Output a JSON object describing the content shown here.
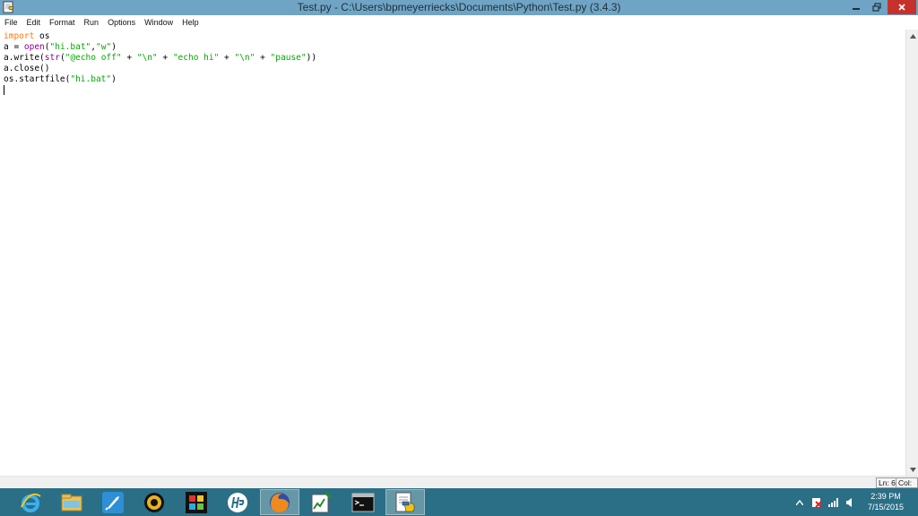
{
  "window": {
    "title": "Test.py - C:\\Users\\bpmeyerriecks\\Documents\\Python\\Test.py (3.4.3)",
    "app_icon": "python-idle-icon",
    "controls": [
      "minimize-icon",
      "maximize-icon",
      "close-icon"
    ]
  },
  "menu": [
    "File",
    "Edit",
    "Format",
    "Run",
    "Options",
    "Window",
    "Help"
  ],
  "editor": {
    "lines": [
      [
        {
          "t": "import",
          "c": "kw"
        },
        {
          "t": " os",
          "c": ""
        }
      ],
      [
        {
          "t": "a = ",
          "c": ""
        },
        {
          "t": "open",
          "c": "bi"
        },
        {
          "t": "(",
          "c": ""
        },
        {
          "t": "\"hi.bat\"",
          "c": "st"
        },
        {
          "t": ",",
          "c": ""
        },
        {
          "t": "\"w\"",
          "c": "st"
        },
        {
          "t": ")",
          "c": ""
        }
      ],
      [
        {
          "t": "a.write(",
          "c": ""
        },
        {
          "t": "str",
          "c": "bi"
        },
        {
          "t": "(",
          "c": ""
        },
        {
          "t": "\"@echo off\"",
          "c": "st"
        },
        {
          "t": " + ",
          "c": ""
        },
        {
          "t": "\"\\n\"",
          "c": "st"
        },
        {
          "t": " + ",
          "c": ""
        },
        {
          "t": "\"echo hi\"",
          "c": "st"
        },
        {
          "t": " + ",
          "c": ""
        },
        {
          "t": "\"\\n\"",
          "c": "st"
        },
        {
          "t": " + ",
          "c": ""
        },
        {
          "t": "\"pause\"",
          "c": "st"
        },
        {
          "t": "))",
          "c": ""
        }
      ],
      [
        {
          "t": "a.close()",
          "c": ""
        }
      ],
      [
        {
          "t": "os.startfile(",
          "c": ""
        },
        {
          "t": "\"hi.bat\"",
          "c": "st"
        },
        {
          "t": ")",
          "c": ""
        }
      ],
      []
    ],
    "colors": {
      "keyword": "#ff7700",
      "builtin": "#900090",
      "string": "#00aa00"
    }
  },
  "status": {
    "line": "Ln: 6",
    "col": "Col: 0"
  },
  "taskbar": {
    "apps": [
      {
        "name": "internet-explorer-icon",
        "active": false
      },
      {
        "name": "file-explorer-icon",
        "active": false
      },
      {
        "name": "rocket-app-icon",
        "active": false
      },
      {
        "name": "media-player-icon",
        "active": false
      },
      {
        "name": "photo-app-icon",
        "active": false
      },
      {
        "name": "hp-icon",
        "active": false
      },
      {
        "name": "firefox-icon",
        "active": true
      },
      {
        "name": "chart-app-icon",
        "active": false
      },
      {
        "name": "command-prompt-icon",
        "active": false
      },
      {
        "name": "python-idle-icon",
        "active": true
      }
    ],
    "tray_icons": [
      "show-hidden-icons-chevron-icon",
      "action-center-icon",
      "network-signal-icon",
      "volume-icon"
    ],
    "time": "2:39 PM",
    "date": "7/15/2015",
    "colors": {
      "bar": "#2a6f86",
      "titlebar": "#6fa4c4",
      "close": "#c7312b"
    }
  }
}
